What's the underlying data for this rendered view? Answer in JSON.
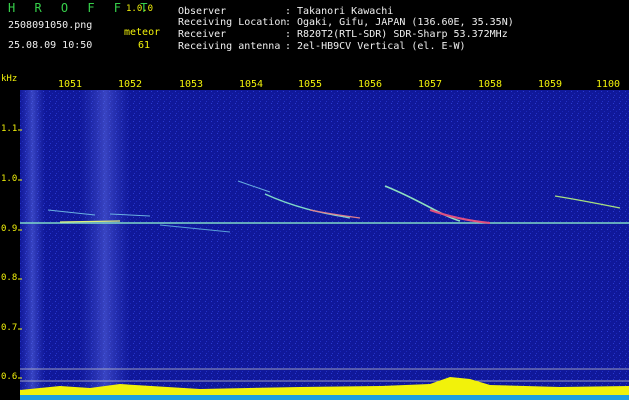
{
  "app": {
    "name": "H R O F F T",
    "version": "1.0.0"
  },
  "file": {
    "name": "2508091050.png",
    "datetime": "25.08.09 10:50"
  },
  "meteor": {
    "label": "meteor",
    "count": "61"
  },
  "info": [
    {
      "key": "Observer",
      "sep": ":",
      "value": "Takanori Kawachi"
    },
    {
      "key": "Receiving Location",
      "sep": ":",
      "value": "Ogaki, Gifu, JAPAN (136.60E, 35.35N)"
    },
    {
      "key": "Receiver",
      "sep": ":",
      "value": "R820T2(RTL-SDR) SDR-Sharp 53.372MHz"
    },
    {
      "key": "Receiving antenna",
      "sep": ":",
      "value": "2el-HB9CV Vertical (el. E-W)"
    }
  ],
  "axis": {
    "y_unit": "kHz",
    "y_ticks": [
      "1.1",
      "1.0",
      "0.9",
      "0.8",
      "0.7",
      "0.6"
    ],
    "x_ticks": [
      "1051",
      "1052",
      "1053",
      "1054",
      "1055",
      "1056",
      "1057",
      "1058",
      "1059",
      "1100"
    ]
  },
  "colors": {
    "label_green": "#36d04a",
    "label_yellow": "#f2f20a",
    "text_white": "#f0f0f0",
    "spectrum_bg": "#10189a"
  }
}
